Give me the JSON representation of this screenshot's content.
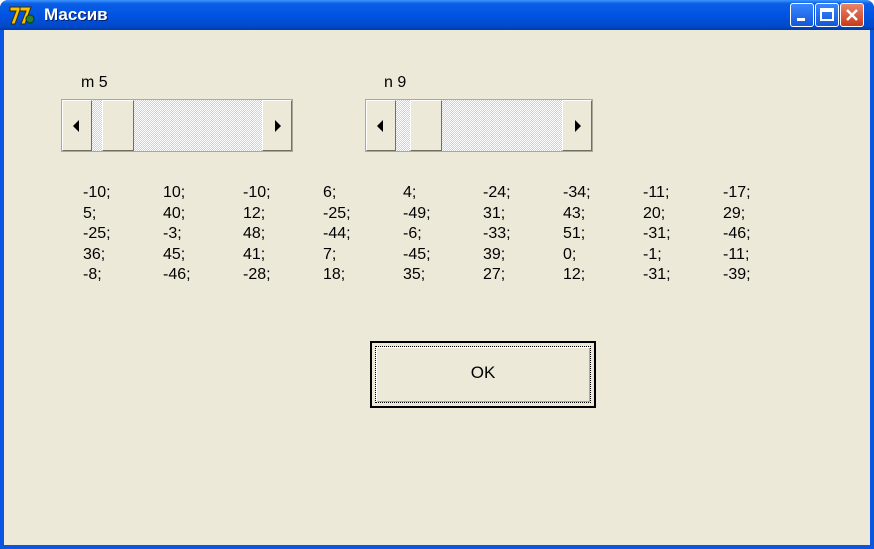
{
  "window": {
    "title": "Массив",
    "minimize_icon": "minimize-icon",
    "maximize_icon": "maximize-icon",
    "close_icon": "close-icon",
    "app_icon": "delphi-app-icon"
  },
  "controls": {
    "m_label": "m 5",
    "n_label": "n 9",
    "m_value": 5,
    "n_value": 9
  },
  "matrix": [
    [
      "-10;",
      "10;",
      "-10;",
      "6;",
      "4;",
      "-24;",
      "-34;",
      "-11;",
      "-17;"
    ],
    [
      "5;",
      "40;",
      "12;",
      "-25;",
      "-49;",
      "31;",
      "43;",
      "20;",
      "29;"
    ],
    [
      "-25;",
      "-3;",
      "48;",
      "-44;",
      "-6;",
      "-33;",
      "51;",
      "-31;",
      "-46;"
    ],
    [
      "36;",
      "45;",
      "41;",
      "7;",
      "-45;",
      "39;",
      "0;",
      "-1;",
      "-11;"
    ],
    [
      "-8;",
      "-46;",
      "-28;",
      "18;",
      "35;",
      "27;",
      "12;",
      "-31;",
      "-39;"
    ]
  ],
  "ok_button": {
    "label": "OK"
  }
}
